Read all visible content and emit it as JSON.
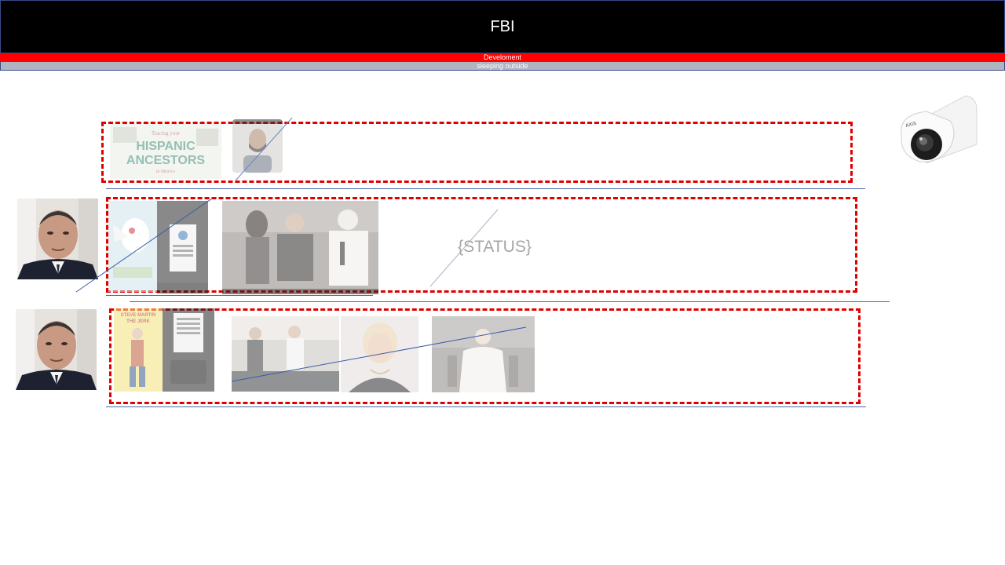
{
  "header": {
    "title": "FBI",
    "subtitle": "Develoment",
    "tagline": "sleeping outside"
  },
  "status": {
    "placeholder": "{STATUS}"
  },
  "thumbnails": {
    "row1": [
      {
        "name": "book-cover-hispanic-ancestors",
        "caption": "Tracing your HISPANIC ANCESTORS in Mexico"
      },
      {
        "name": "man-portrait-photo"
      }
    ],
    "row2": [
      {
        "name": "cartoon-poster"
      },
      {
        "name": "vhs-tape"
      },
      {
        "name": "group-photo"
      }
    ],
    "row3": [
      {
        "name": "movie-poster-steve-martin",
        "caption": "STEVE MARTIN THE JERK"
      },
      {
        "name": "vhs-tape-2"
      },
      {
        "name": "two-men-car-photo"
      },
      {
        "name": "woman-portrait-photo"
      },
      {
        "name": "elderly-man-chair-photo"
      }
    ]
  },
  "colors": {
    "header_bg": "#000000",
    "accent_red": "#ff0000",
    "dash_red": "#e00000",
    "grey_bar": "#b0b3c0",
    "line_blue": "#4a6aa8",
    "status_grey": "#a6a6a6"
  },
  "icons": {
    "camera": "security-camera-icon"
  }
}
